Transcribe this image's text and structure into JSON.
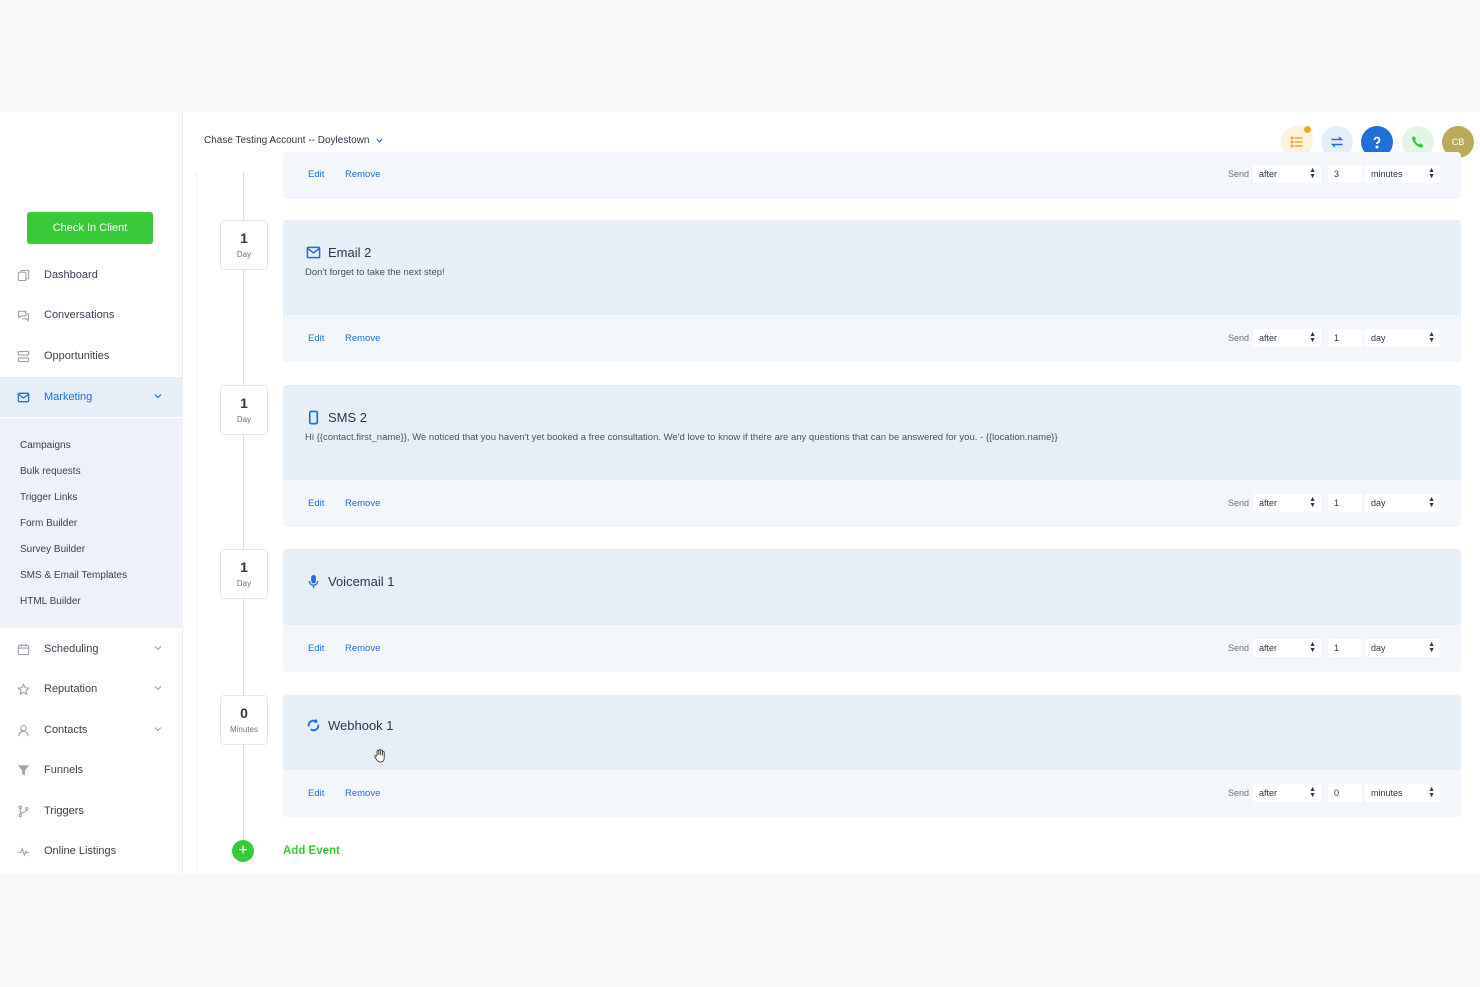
{
  "header": {
    "account_name": "Chase Testing Account -- Doylestown",
    "avatar_initials": "CB",
    "colors": {
      "tasks_bg": "#fdf3dc",
      "switch_bg": "#e4eef8",
      "help_bg": "#1e6fd9",
      "phone_bg": "#e3f5e6",
      "avatar_bg": "#b9ab5a",
      "notification_dot": "#f5a623"
    }
  },
  "sidebar": {
    "check_in_label": "Check In Client",
    "items": [
      {
        "label": "Dashboard",
        "icon": "dashboard-icon"
      },
      {
        "label": "Conversations",
        "icon": "chat-icon"
      },
      {
        "label": "Opportunities",
        "icon": "opportunities-icon"
      },
      {
        "label": "Marketing",
        "icon": "mail-icon"
      },
      {
        "label": "Scheduling",
        "icon": "calendar-icon"
      },
      {
        "label": "Reputation",
        "icon": "star-icon"
      },
      {
        "label": "Contacts",
        "icon": "user-icon"
      },
      {
        "label": "Funnels",
        "icon": "funnel-icon"
      },
      {
        "label": "Triggers",
        "icon": "branch-icon"
      },
      {
        "label": "Online Listings",
        "icon": "pulse-icon"
      }
    ],
    "marketing_submenu": [
      "Campaigns",
      "Bulk requests",
      "Trigger Links",
      "Form Builder",
      "Survey Builder",
      "SMS & Email Templates",
      "HTML Builder"
    ]
  },
  "partial_card": {
    "edit": "Edit",
    "remove": "Remove",
    "send": "Send",
    "after": "after",
    "amount": "3",
    "unit": "minutes"
  },
  "events": [
    {
      "delay_value": "1",
      "delay_unit": "Day",
      "icon": "email-icon",
      "title": "Email 2",
      "description": "Don't forget to take the next step!",
      "edit": "Edit",
      "remove": "Remove",
      "send": "Send",
      "after": "after",
      "amount": "1",
      "unit": "day"
    },
    {
      "delay_value": "1",
      "delay_unit": "Day",
      "icon": "phone-sms-icon",
      "title": "SMS 2",
      "description": "Hi {{contact.first_name}}, We noticed that you haven't yet booked a free consultation. We'd love to know if there are any questions that can be answered for you. - {{location.name}}",
      "edit": "Edit",
      "remove": "Remove",
      "send": "Send",
      "after": "after",
      "amount": "1",
      "unit": "day"
    },
    {
      "delay_value": "1",
      "delay_unit": "Day",
      "icon": "microphone-icon",
      "title": "Voicemail 1",
      "description": "",
      "edit": "Edit",
      "remove": "Remove",
      "send": "Send",
      "after": "after",
      "amount": "1",
      "unit": "day"
    },
    {
      "delay_value": "0",
      "delay_unit": "Minutes",
      "icon": "webhook-icon",
      "title": "Webhook 1",
      "description": "",
      "edit": "Edit",
      "remove": "Remove",
      "send": "Send",
      "after": "after",
      "amount": "0",
      "unit": "minutes"
    }
  ],
  "add_event_label": "Add Event"
}
